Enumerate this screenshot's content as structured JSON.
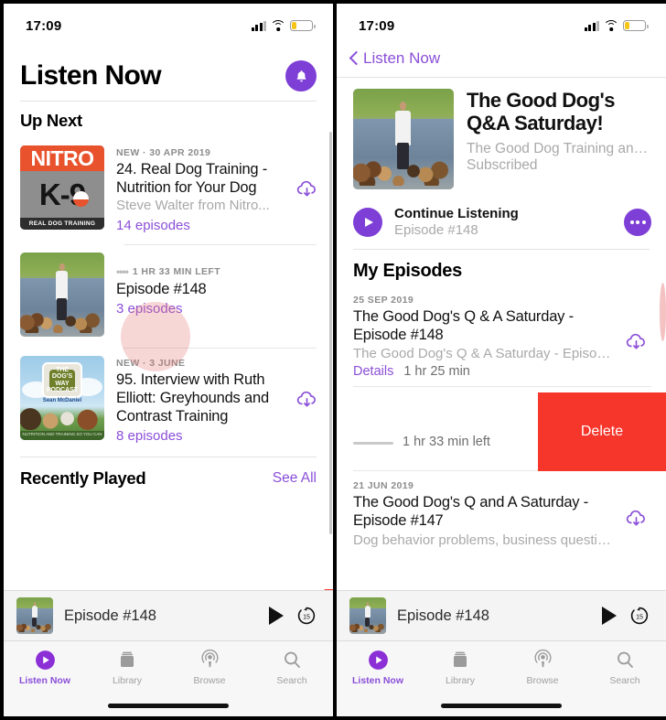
{
  "meta": {
    "accent_purple": "#8b4fd8",
    "accent_purple_dark": "#7d3fd6",
    "delete_red": "#f6352b",
    "tap_pink": "rgba(230,120,120,0.30)"
  },
  "status_bar": {
    "time": "17:09",
    "signal_icon": "cellular-signal-icon",
    "wifi_icon": "wifi-icon",
    "battery_icon": "battery-low-icon",
    "battery_level_percent": 22
  },
  "left_screen": {
    "header": {
      "title": "Listen Now",
      "bell_icon": "bell-icon"
    },
    "up_next": {
      "section_title": "Up Next",
      "items": [
        {
          "eyebrow": "NEW · 30 APR 2019",
          "title": "24. Real Dog Training - Nutrition for Your Dog",
          "subtitle": "Steve Walter from Nitro...",
          "link": "14 episodes",
          "download_icon": "download-cloud-icon",
          "artwork": "nitro-k9-artwork",
          "artwork_text": {
            "top": "NITRO",
            "middle": "K-9",
            "bottom": "REAL DOG TRAINING"
          }
        },
        {
          "eyebrow": "1 HR 33 MIN LEFT",
          "has_progress_dots": true,
          "title": "Episode #148",
          "subtitle": "",
          "link": "3 episodes",
          "download_icon": null,
          "artwork": "good-dog-walking-artwork",
          "tap_indicator": true
        },
        {
          "eyebrow": "NEW · 3 JUNE",
          "title": "95. Interview with Ruth Elliott: Greyhounds and Contrast Training",
          "subtitle": "",
          "link": "8 episodes",
          "download_icon": "download-cloud-icon",
          "artwork": "dogs-way-artwork",
          "artwork_text": {
            "badge": "THE DOG'S WAY PODCAST",
            "host": "Sean McDaniel",
            "strip": "NUTRITION AND TRAINING SO YOU CAN ENJOY YOUR DOG"
          }
        }
      ]
    },
    "recently_played": {
      "section_title": "Recently Played",
      "see_all": "See All"
    }
  },
  "right_screen": {
    "nav": {
      "back_label": "Listen Now",
      "back_icon": "chevron-left-icon"
    },
    "show": {
      "title": "The Good Dog's Q&A Saturday!",
      "author": "The Good Dog Training and...",
      "status": "Subscribed",
      "artwork": "good-dog-walking-artwork"
    },
    "continue_listening": {
      "title": "Continue Listening",
      "subtitle": "Episode #148",
      "play_icon": "play-circle-icon",
      "more_icon": "ellipsis-icon"
    },
    "episodes_section_title": "My Episodes",
    "episodes": [
      {
        "date": "25 SEP 2019",
        "title": "The Good Dog's Q & A Saturday - Episode #148",
        "description": "The Good Dog's Q & A Saturday - Episod...",
        "details_label": "Details",
        "duration": "1 hr 25 min",
        "download_icon": "download-cloud-icon"
      },
      {
        "swiped": true,
        "time_left": "1 hr 33 min left",
        "delete_label": "Delete"
      },
      {
        "date": "21 JUN 2019",
        "title": "The Good Dog's Q and A Saturday - Episode #147",
        "description": "Dog behavior problems, business questio...",
        "download_icon": "download-cloud-icon"
      }
    ]
  },
  "player_bar": {
    "title": "Episode #148",
    "play_icon": "play-icon",
    "skip_forward_icon": "skip-forward-15-icon",
    "skip_seconds": "15",
    "artwork": "good-dog-walking-artwork"
  },
  "tab_bar": {
    "tabs": [
      {
        "label": "Listen Now",
        "icon": "play-circle-icon",
        "active": true
      },
      {
        "label": "Library",
        "icon": "library-icon",
        "active": false
      },
      {
        "label": "Browse",
        "icon": "broadcast-icon",
        "active": false
      },
      {
        "label": "Search",
        "icon": "search-icon",
        "active": false
      }
    ]
  }
}
